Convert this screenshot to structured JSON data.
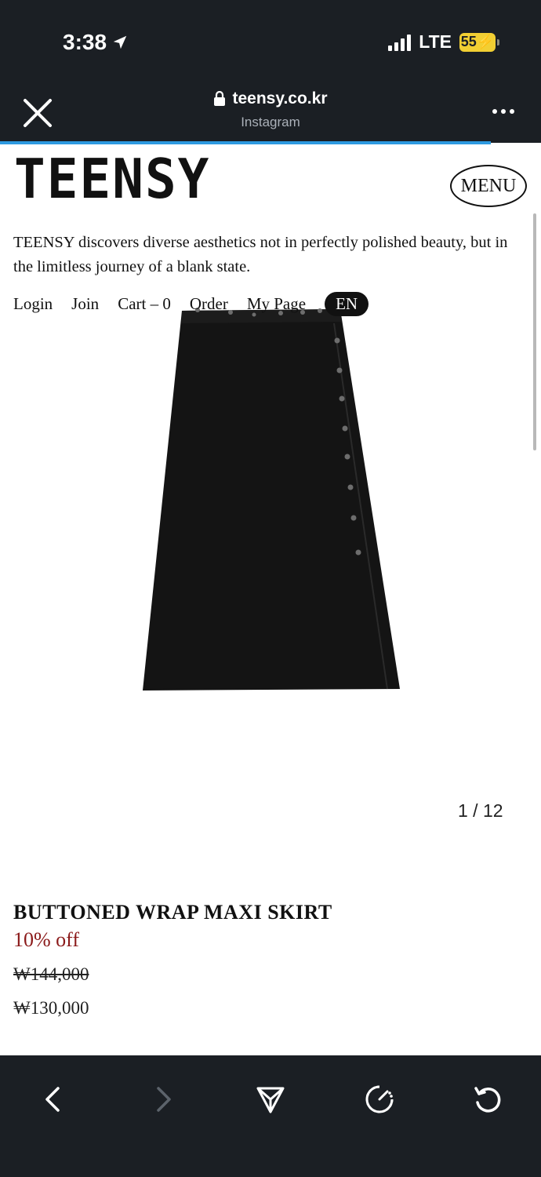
{
  "status": {
    "time": "3:38",
    "network": "LTE",
    "battery": "55"
  },
  "browser": {
    "url": "teensy.co.kr",
    "source": "Instagram",
    "load_progress": 0.907
  },
  "site": {
    "logo": "TEENSY",
    "menu_label": "MENU",
    "tagline": "TEENSY discovers diverse aesthetics not in perfectly polished beauty, but in the limitless journey of a blank state.",
    "nav": {
      "login": "Login",
      "join": "Join",
      "cart": "Cart – 0",
      "order": "Order",
      "mypage": "My Page",
      "lang": "EN"
    }
  },
  "product": {
    "image_counter": "1 / 12",
    "name": "BUTTONED WRAP MAXI SKIRT",
    "discount": "10% off",
    "original_price": "₩144,000",
    "sale_price": "₩130,000"
  },
  "icons": {
    "close": "close-icon",
    "lock": "lock-icon",
    "more": "more-icon",
    "back": "chevron-left-icon",
    "forward": "chevron-right-icon",
    "share": "share-icon",
    "speed": "speedometer-icon",
    "refresh": "refresh-icon"
  },
  "colors": {
    "chrome_bg": "#1b1f24",
    "progress": "#2e9ae0",
    "discount_red": "#8b1a1a",
    "battery_yellow": "#f2cf33"
  }
}
